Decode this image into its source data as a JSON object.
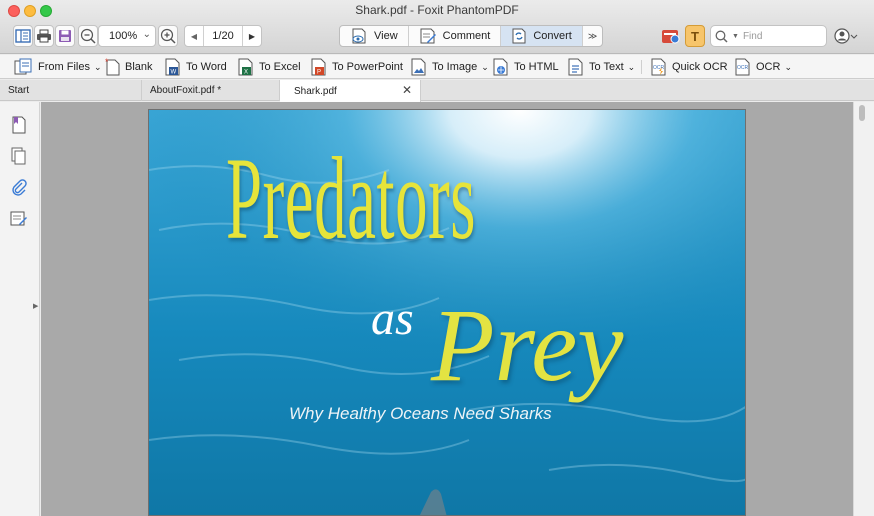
{
  "window": {
    "title": "Shark.pdf - Foxit PhantomPDF"
  },
  "toolbar": {
    "zoom_value": "100%",
    "page_value": "1/20",
    "modes": [
      {
        "label": "View",
        "icon": "view-icon",
        "active": false
      },
      {
        "label": "Comment",
        "icon": "comment-icon",
        "active": false
      },
      {
        "label": "Convert",
        "icon": "convert-icon",
        "active": true
      }
    ],
    "find_placeholder": "Find"
  },
  "ribbon": {
    "items": [
      {
        "label": "From Files",
        "icon": "from-files-icon",
        "dropdown": true
      },
      {
        "label": "Blank",
        "icon": "blank-page-icon",
        "dropdown": false
      },
      {
        "label": "To Word",
        "icon": "word-icon",
        "dropdown": false
      },
      {
        "label": "To Excel",
        "icon": "excel-icon",
        "dropdown": false
      },
      {
        "label": "To PowerPoint",
        "icon": "powerpoint-icon",
        "dropdown": false
      },
      {
        "label": "To Image",
        "icon": "image-icon",
        "dropdown": true
      },
      {
        "label": "To HTML",
        "icon": "html-icon",
        "dropdown": false
      },
      {
        "label": "To Text",
        "icon": "text-icon",
        "dropdown": true
      },
      {
        "label": "Quick OCR",
        "icon": "quick-ocr-icon",
        "dropdown": false
      },
      {
        "label": "OCR",
        "icon": "ocr-icon",
        "dropdown": true
      }
    ]
  },
  "tabs": [
    {
      "label": "Start",
      "active": false,
      "closable": false
    },
    {
      "label": "AboutFoxit.pdf *",
      "active": false,
      "closable": false
    },
    {
      "label": "Shark.pdf",
      "active": true,
      "closable": true
    }
  ],
  "document": {
    "title_line1": "Predators",
    "title_as": "as",
    "title_prey": "Prey",
    "subtitle": "Why Healthy Oceans Need Sharks"
  },
  "colors": {
    "accent_active": "#d6e3f2",
    "title_yellow": "#e6e43a",
    "ocean_blue": "#1683b2"
  }
}
